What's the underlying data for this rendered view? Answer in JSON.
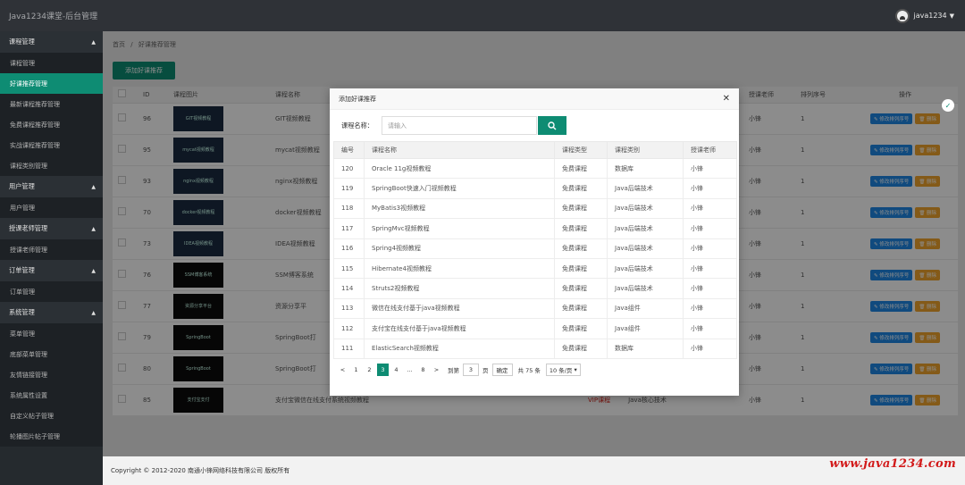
{
  "header": {
    "brand": "Java1234课堂-后台管理",
    "username": "java1234"
  },
  "sidebar": {
    "groups": [
      {
        "label": "课程管理",
        "items": [
          "课程管理",
          "好课推荐管理",
          "最新课程推荐管理",
          "免费课程推荐管理",
          "实战课程推荐管理",
          "课程类别管理"
        ]
      },
      {
        "label": "用户管理",
        "items": [
          "用户管理"
        ]
      },
      {
        "label": "授课老师管理",
        "items": [
          "授课老师管理"
        ]
      },
      {
        "label": "订单管理",
        "items": [
          "订单管理"
        ]
      },
      {
        "label": "系统管理",
        "items": [
          "菜单管理",
          "底部菜单管理",
          "友情链接管理",
          "系统属性设置",
          "自定义帖子管理",
          "轮播图片帖子管理"
        ]
      }
    ]
  },
  "breadcrumb": {
    "home": "首页",
    "sep": "/",
    "current": "好课推荐管理"
  },
  "add_button": "添加好课推荐",
  "bg_table": {
    "headers": [
      "",
      "ID",
      "课程图片",
      "课程名称",
      "",
      "授课老师",
      "排列序号",
      "操作"
    ],
    "rows": [
      {
        "id": "96",
        "thumb": "GIT视频教程",
        "name": "GIT视频教程",
        "teacher": "小锋",
        "order": "1"
      },
      {
        "id": "95",
        "thumb": "mycat视频教程",
        "name": "mycat视频教程",
        "teacher": "小锋",
        "order": "1"
      },
      {
        "id": "93",
        "thumb": "nginx视频教程",
        "name": "nginx视频教程",
        "teacher": "小锋",
        "order": "1"
      },
      {
        "id": "70",
        "thumb": "docker视频教程",
        "name": "docker视频教程",
        "teacher": "小锋",
        "order": "1"
      },
      {
        "id": "73",
        "thumb": "IDEA视频教程",
        "name": "IDEA视频教程",
        "teacher": "小锋",
        "order": "1"
      },
      {
        "id": "76",
        "thumb": "SSM博客系统",
        "name": "SSM博客系统",
        "teacher": "小锋",
        "order": "1"
      },
      {
        "id": "77",
        "thumb": "资源分享平台",
        "name": "资源分享平",
        "teacher": "小锋",
        "order": "1"
      },
      {
        "id": "79",
        "thumb": "SpringBoot",
        "name": "SpringBoot打",
        "teacher": "小锋",
        "order": "1"
      },
      {
        "id": "80",
        "thumb": "SpringBoot",
        "name": "SpringBoot打",
        "teacher": "小锋",
        "order": "1"
      },
      {
        "id": "85",
        "thumb": "支付宝支付",
        "name": "支付宝微信在线支付系统视频教程",
        "type": "VIP课程",
        "category": "Java核心技术",
        "teacher": "小锋",
        "order": "1"
      }
    ],
    "edit_label": "修改排列序号",
    "delete_label": "删除"
  },
  "modal": {
    "title": "添加好课推荐",
    "search_label": "课程名称：",
    "search_placeholder": "请输入",
    "headers": [
      "编号",
      "课程名称",
      "课程类型",
      "课程类别",
      "授课老师"
    ],
    "rows": [
      {
        "id": "120",
        "name": "Oracle 11g视频教程",
        "type": "免费课程",
        "category": "数据库",
        "teacher": "小锋"
      },
      {
        "id": "119",
        "name": "SpringBoot快速入门视频教程",
        "type": "免费课程",
        "category": "Java后端技术",
        "teacher": "小锋"
      },
      {
        "id": "118",
        "name": "MyBatis3视频教程",
        "type": "免费课程",
        "category": "Java后端技术",
        "teacher": "小锋"
      },
      {
        "id": "117",
        "name": "SpringMvc视频教程",
        "type": "免费课程",
        "category": "Java后端技术",
        "teacher": "小锋"
      },
      {
        "id": "116",
        "name": "Spring4视频教程",
        "type": "免费课程",
        "category": "Java后端技术",
        "teacher": "小锋"
      },
      {
        "id": "115",
        "name": "Hibernate4视频教程",
        "type": "免费课程",
        "category": "Java后端技术",
        "teacher": "小锋"
      },
      {
        "id": "114",
        "name": "Struts2视频教程",
        "type": "免费课程",
        "category": "Java后端技术",
        "teacher": "小锋"
      },
      {
        "id": "113",
        "name": "微信在线支付基于java视频教程",
        "type": "免费课程",
        "category": "Java组件",
        "teacher": "小锋"
      },
      {
        "id": "112",
        "name": "支付宝在线支付基于java视频教程",
        "type": "免费课程",
        "category": "Java组件",
        "teacher": "小锋"
      },
      {
        "id": "111",
        "name": "ElasticSearch视频教程",
        "type": "免费课程",
        "category": "数据库",
        "teacher": "小锋"
      }
    ],
    "pagination": {
      "prev": "<",
      "pages": [
        "1",
        "2",
        "3",
        "4",
        "…",
        "8"
      ],
      "current": "3",
      "next": ">",
      "goto_label": "到第",
      "goto_value": "3",
      "page_unit": "页",
      "confirm": "确定",
      "total": "共 75 条",
      "page_size": "10 条/页"
    }
  },
  "footer": {
    "copyright": "Copyright © 2012-2020 南通小锋网络科技有限公司 版权所有"
  },
  "watermark": "www.java1234.com"
}
